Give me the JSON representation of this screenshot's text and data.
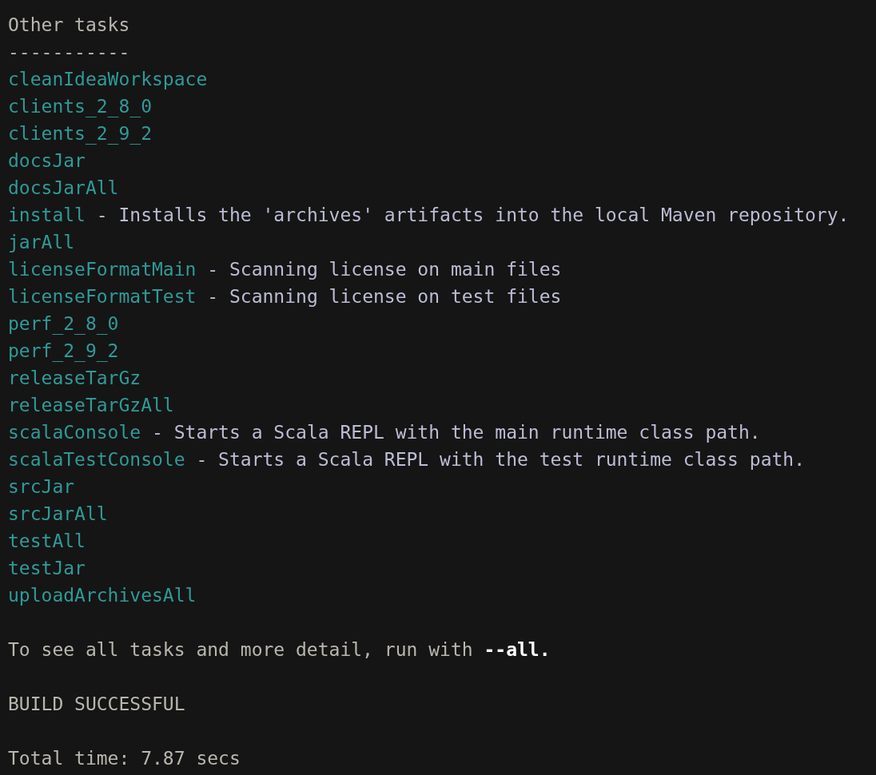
{
  "heading": "Other tasks",
  "separator": "-----------",
  "tasks": [
    {
      "name": "cleanIdeaWorkspace"
    },
    {
      "name": "clients_2_8_0"
    },
    {
      "name": "clients_2_9_2"
    },
    {
      "name": "docsJar"
    },
    {
      "name": "docsJarAll"
    },
    {
      "name": "install",
      "description": "- Installs the 'archives' artifacts into the local Maven repository."
    },
    {
      "name": "jarAll"
    },
    {
      "name": "licenseFormatMain",
      "description": "- Scanning license on main files"
    },
    {
      "name": "licenseFormatTest",
      "description": "- Scanning license on test files"
    },
    {
      "name": "perf_2_8_0"
    },
    {
      "name": "perf_2_9_2"
    },
    {
      "name": "releaseTarGz"
    },
    {
      "name": "releaseTarGzAll"
    },
    {
      "name": "scalaConsole",
      "description": "- Starts a Scala REPL with the main runtime class path."
    },
    {
      "name": "scalaTestConsole",
      "description": "- Starts a Scala REPL with the test runtime class path."
    },
    {
      "name": "srcJar"
    },
    {
      "name": "srcJarAll"
    },
    {
      "name": "testAll"
    },
    {
      "name": "testJar"
    },
    {
      "name": "uploadArchivesAll"
    }
  ],
  "hint": "To see all tasks and more detail, run with **--all.**",
  "status": "BUILD SUCCESSFUL",
  "total_time": "Total time: 7.87 secs"
}
